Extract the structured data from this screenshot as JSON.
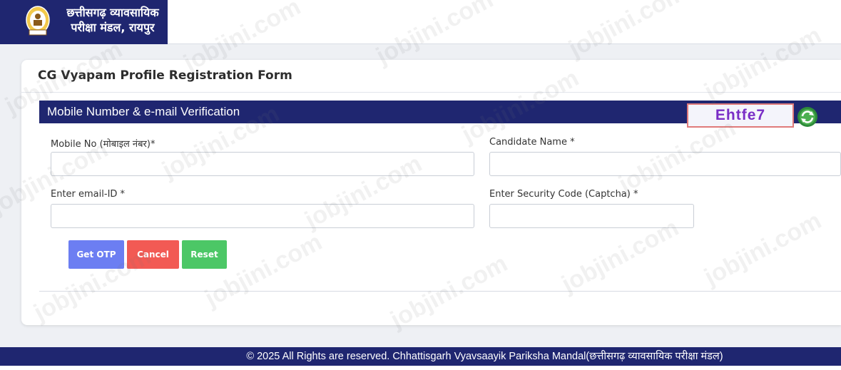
{
  "header": {
    "org_name_line1": "छत्तीसगढ़ व्यावसायिक",
    "org_name_line2": "परीक्षा मंडल, रायपुर",
    "logo_icon": "cg-vyapam-emblem-icon",
    "brand_color": "#1f2670"
  },
  "form": {
    "title": "CG Vyapam Profile Registration Form",
    "section_title": "Mobile Number & e-mail Verification",
    "fields": {
      "mobile_label": "Mobile No (मोबाइल नंबर)*",
      "mobile_value": "",
      "name_label": "Candidate Name *",
      "name_value": "",
      "email_label": "Enter email-ID *",
      "email_value": "",
      "captcha_label": "Enter Security Code (Captcha) *",
      "captcha_value": ""
    },
    "captcha_code": "Ehtfe7",
    "refresh_icon": "refresh-icon",
    "buttons": {
      "get_otp": "Get OTP",
      "cancel": "Cancel",
      "reset": "Reset"
    },
    "colors": {
      "get_otp": "#6c7ef2",
      "cancel": "#f25a54",
      "reset": "#4cc766"
    }
  },
  "watermark_text": "jobjini.com",
  "footer": {
    "text": "© 2025 All Rights are reserved. Chhattisgarh Vyavsaayik Pariksha Mandal(छत्तीसगढ़ व्यावसायिक परीक्षा मंडल)"
  }
}
